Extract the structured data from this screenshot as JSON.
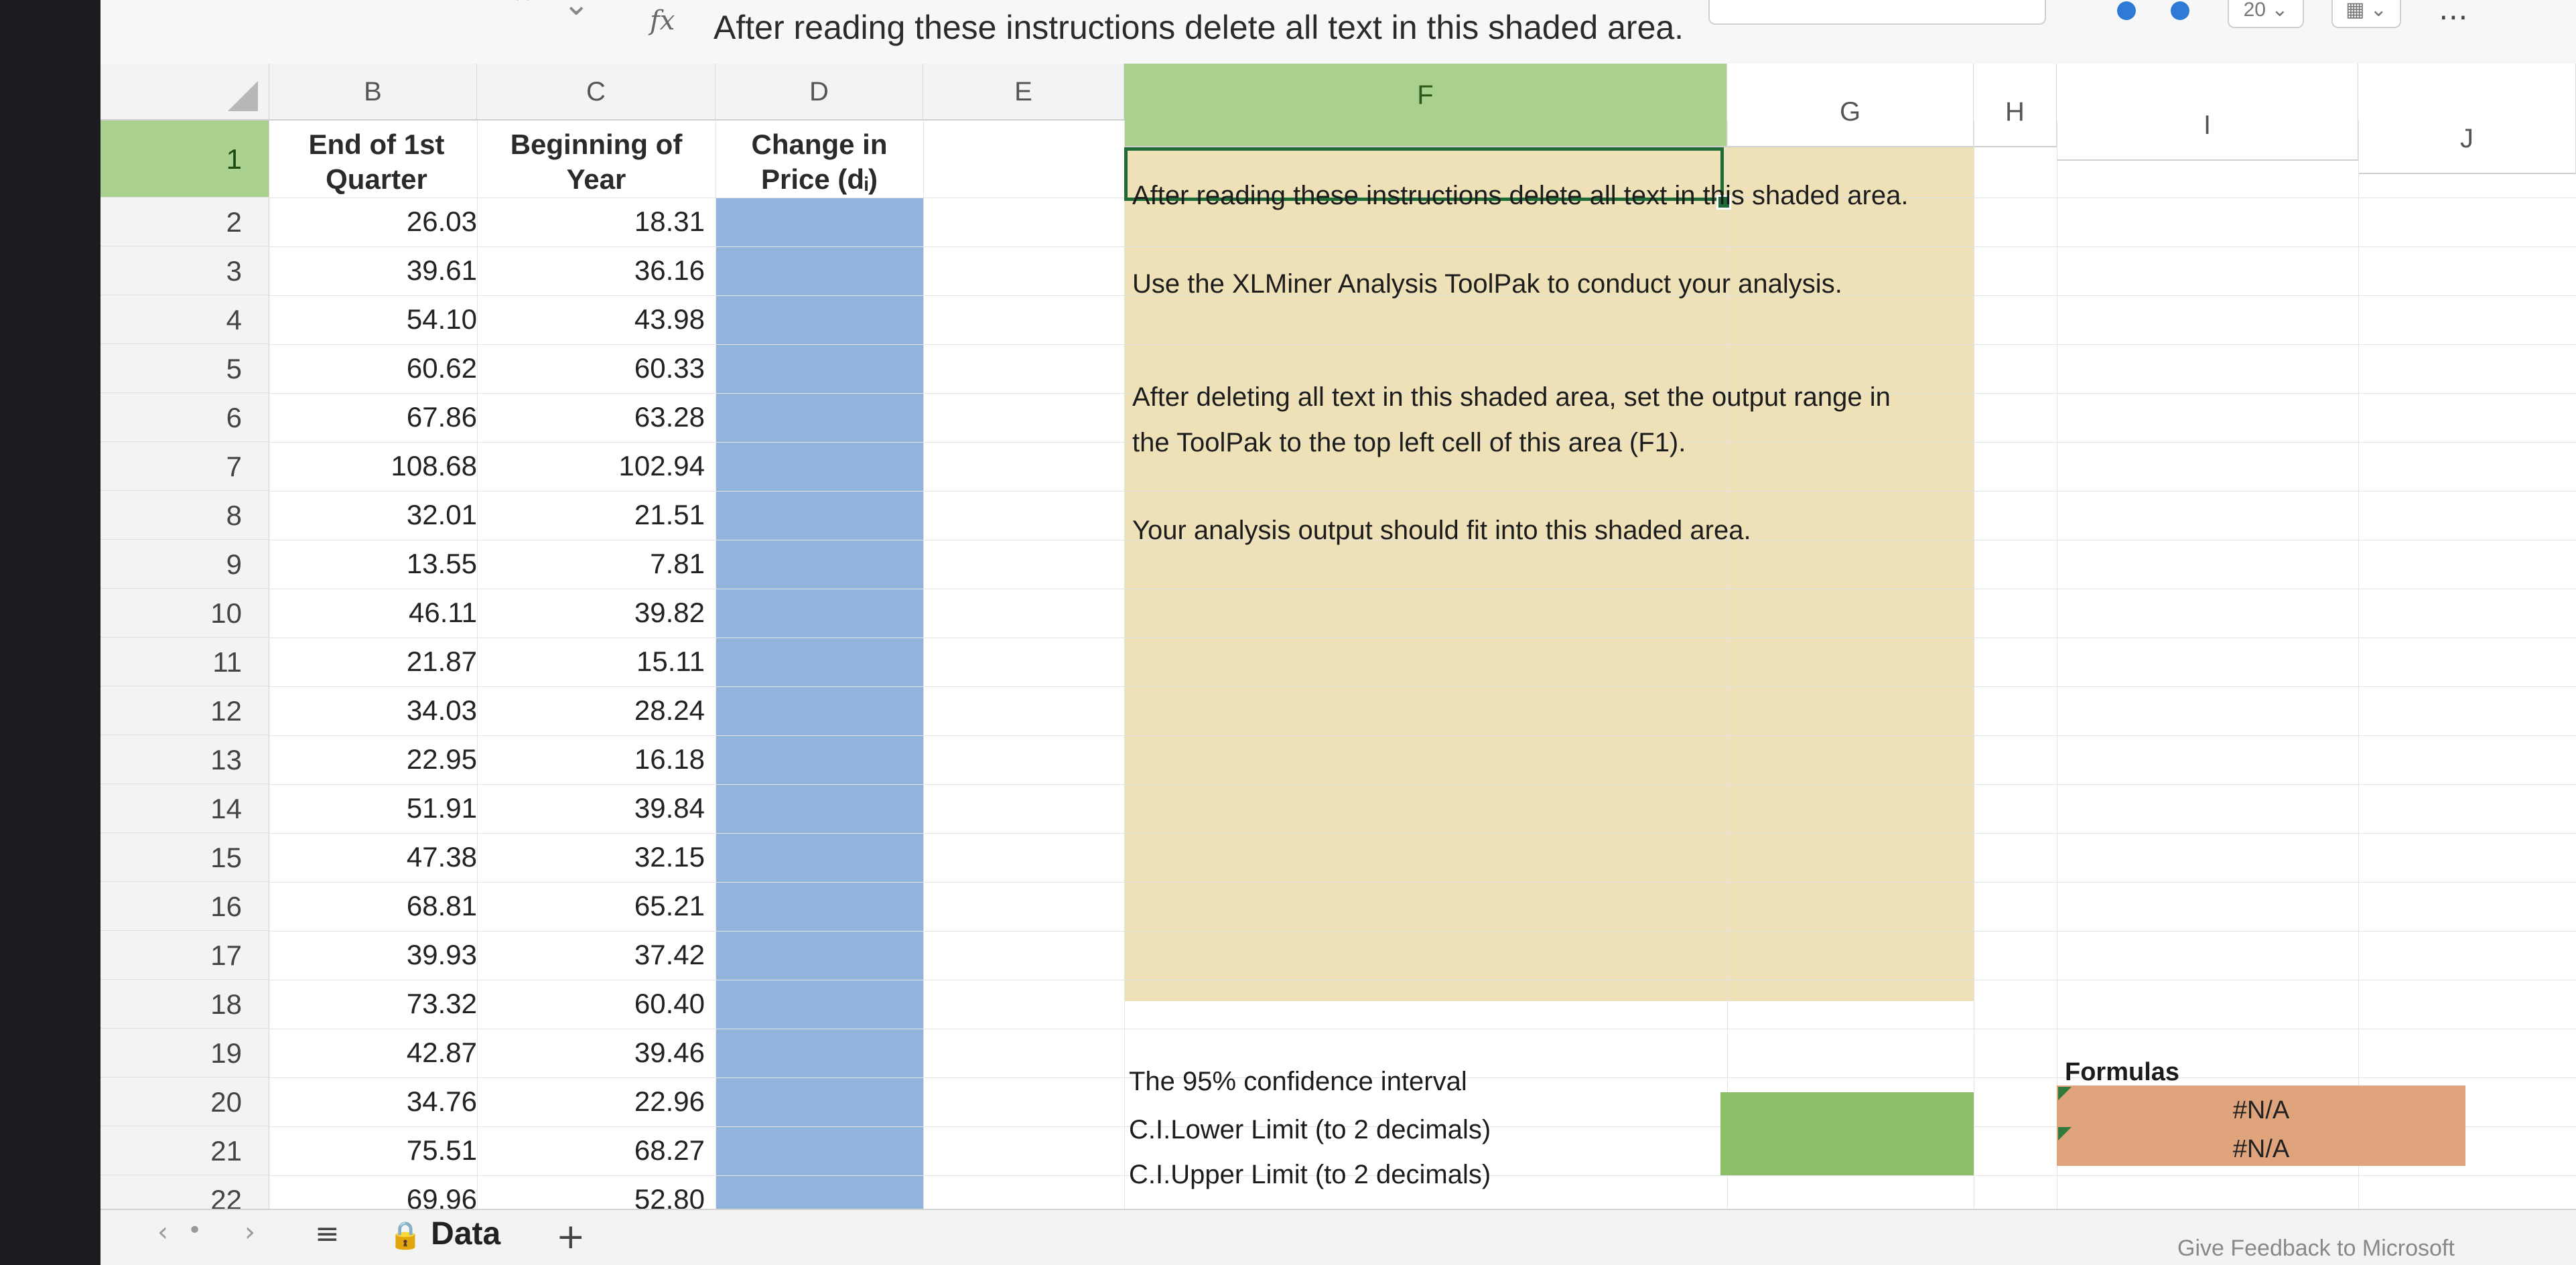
{
  "formula_bar": {
    "fx": "fx",
    "text": "After reading these instructions delete all text in this shaded area.",
    "right_pill": "20"
  },
  "columns": [
    "B",
    "C",
    "D",
    "E",
    "F",
    "G",
    "H",
    "I",
    "J"
  ],
  "rows": [
    "1",
    "2",
    "3",
    "4",
    "5",
    "6",
    "7",
    "8",
    "9",
    "10",
    "11",
    "12",
    "13",
    "14",
    "15",
    "16",
    "17",
    "18",
    "19",
    "20",
    "21",
    "22"
  ],
  "headers": {
    "b": [
      "End of 1st",
      "Quarter"
    ],
    "c": [
      "Beginning of",
      "Year"
    ],
    "d": [
      "Change in",
      "Price (dᵢ)"
    ]
  },
  "col_b": [
    "26.03",
    "39.61",
    "54.10",
    "60.62",
    "67.86",
    "108.68",
    "32.01",
    "13.55",
    "46.11",
    "21.87",
    "34.03",
    "22.95",
    "51.91",
    "47.38",
    "68.81",
    "39.93",
    "73.32",
    "42.87",
    "34.76",
    "75.51",
    "69.96"
  ],
  "col_c": [
    "18.31",
    "36.16",
    "43.98",
    "60.33",
    "63.28",
    "102.94",
    "21.51",
    "7.81",
    "39.82",
    "15.11",
    "28.24",
    "16.18",
    "39.84",
    "32.15",
    "65.21",
    "37.42",
    "60.40",
    "39.46",
    "22.96",
    "68.27",
    "52.80"
  ],
  "instructions": {
    "line1": "After reading these instructions delete all text in this shaded area.",
    "line2": "Use the XLMiner Analysis ToolPak to conduct your analysis.",
    "line3a": "After deleting all text in this shaded area, set the output range in",
    "line3b": "the ToolPak to the top left cell of this area (F1).",
    "line4": "Your analysis output should fit into this shaded area."
  },
  "ci": {
    "label": "The 95% confidence  interval",
    "lower": "C.I.Lower Limit (to 2 decimals)",
    "upper": "C.I.Upper Limit (to 2 decimals)"
  },
  "formulas": {
    "label": "Formulas",
    "values": [
      "#N/A",
      "#N/A"
    ]
  },
  "tabs": {
    "sheet": "Data",
    "add": "+",
    "feedback": "Give Feedback to Microsoft"
  },
  "colors": {
    "selected_header": "#a9d08e",
    "shade_blue": "#92b4dc",
    "shade_yellow": "#efe1b7",
    "green_cell": "#8cbf6a",
    "orange_cell": "#e0a47d"
  }
}
